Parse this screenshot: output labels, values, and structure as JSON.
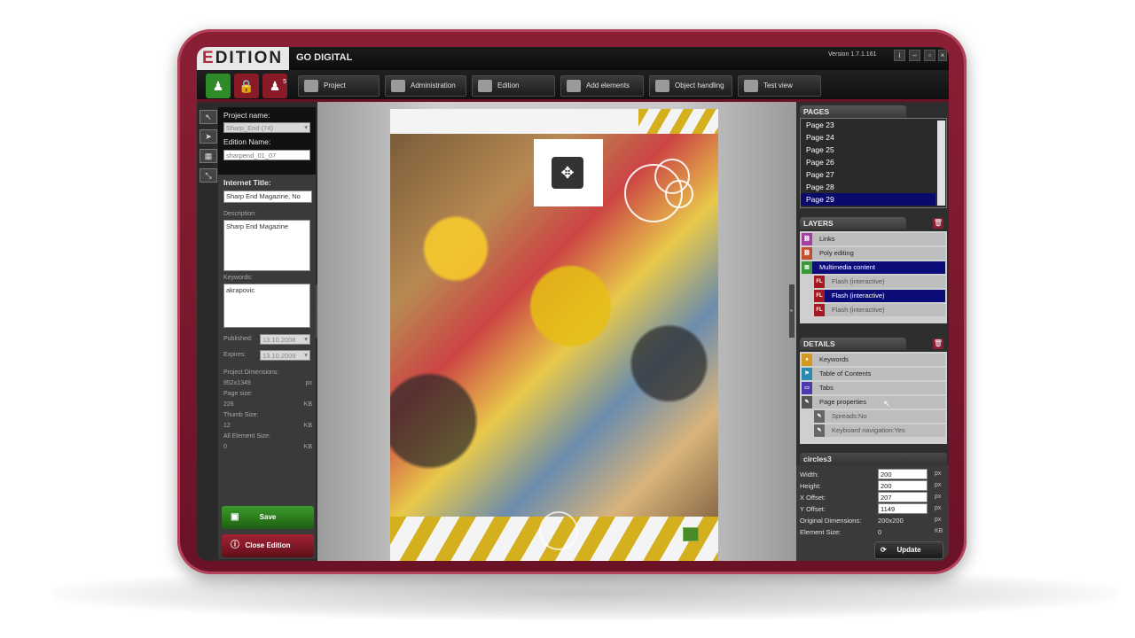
{
  "app": {
    "logo_prefix": "E",
    "logo_rest": "DITION",
    "tagline": "GO DIGITAL",
    "version": "Version 1.7.1.161",
    "badge_count": "5"
  },
  "toolbar": {
    "project": "Project",
    "administration": "Administration",
    "edition": "Edition",
    "add_elements": "Add elements",
    "object_handling": "Object handling",
    "test_view": "Test view"
  },
  "left": {
    "project_name_label": "Project name:",
    "project_name_value": "Sharp_End (74)",
    "edition_name_label": "Edition Name:",
    "edition_name_value": "sharpend_01_07",
    "internet_title_label": "Internet Title:",
    "internet_title_value": "Sharp End Magazine, No",
    "description_label": "Description:",
    "description_value": "Sharp End Magazine",
    "keywords_label": "Keywords:",
    "keywords_value": "akrapovic",
    "published_label": "Published:",
    "published_value": "13.10.2008",
    "expires_label": "Expires:",
    "expires_value": "13.10.2009",
    "project_dim_label": "Project Dimensions:",
    "project_dim_value": "952x1349",
    "project_dim_unit": "px",
    "page_size_label": "Page size:",
    "page_size_value": "226",
    "page_size_unit": "KB",
    "thumb_size_label": "Thumb Size:",
    "thumb_size_value": "12",
    "thumb_size_unit": "KB",
    "all_element_label": "All Element Size:",
    "all_element_value": "0",
    "all_element_unit": "KB",
    "save": "Save",
    "close_edition": "Close Edition"
  },
  "pages": {
    "header": "PAGES",
    "items": [
      "Page 23",
      "Page 24",
      "Page 25",
      "Page 26",
      "Page 27",
      "Page 28",
      "Page 29"
    ]
  },
  "layers": {
    "header": "LAYERS",
    "items": [
      "Links",
      "Poly editing",
      "Multimedia content",
      "Flash (interactive)",
      "Flash (interactive)",
      "Flash (interactive)"
    ],
    "fl_tag": "FL"
  },
  "details": {
    "header": "DETAILS",
    "items": [
      "Keywords",
      "Table of Contents",
      "Tabs",
      "Page properties",
      "Spreads:No",
      "Keyboard navigation:Yes"
    ]
  },
  "element": {
    "header": "circles3",
    "width_label": "Width:",
    "width_value": "200",
    "height_label": "Height:",
    "height_value": "200",
    "xoffset_label": "X Offset:",
    "xoffset_value": "207",
    "yoffset_label": "Y Offset:",
    "yoffset_value": "1149",
    "orig_dim_label": "Original Dimensions:",
    "orig_dim_value": "200x200",
    "elem_size_label": "Element Size:",
    "elem_size_value": "0",
    "unit_px": "px",
    "unit_kb": "KB",
    "update": "Update"
  },
  "colors": {
    "brand": "#8a1f34",
    "selection": "#0d0d7a",
    "save_green": "#2f7d1f",
    "close_red": "#8a1a28"
  }
}
